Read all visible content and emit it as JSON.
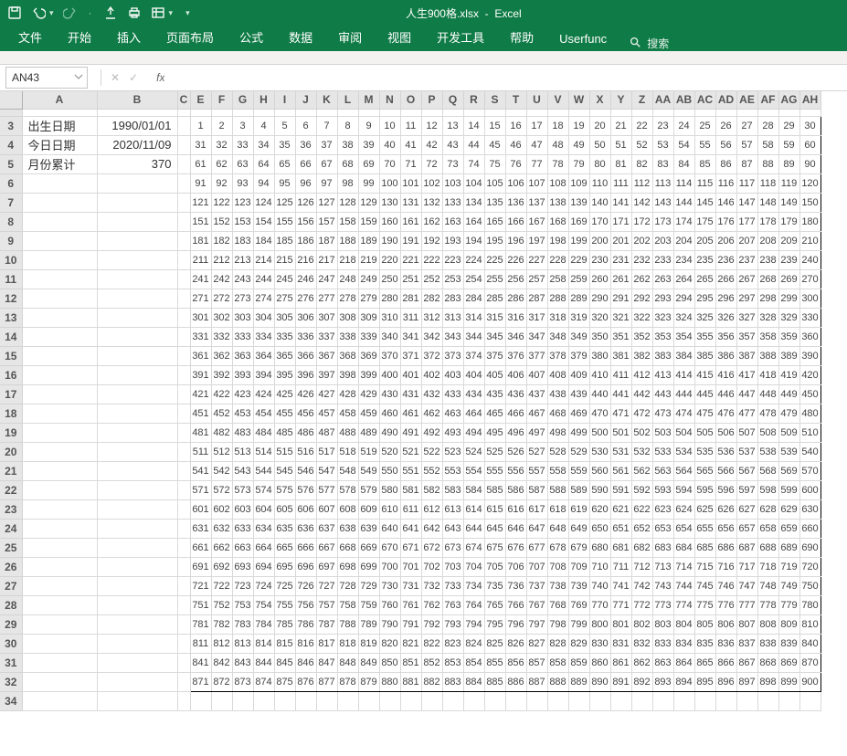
{
  "app": {
    "filename": "人生900格.xlsx",
    "appname": "Excel"
  },
  "qat": {
    "save": "save",
    "undo": "undo",
    "redo": "redo",
    "touch": "touch",
    "print": "print",
    "table": "table",
    "more": "▾"
  },
  "ribbon": {
    "tabs": [
      "文件",
      "开始",
      "插入",
      "页面布局",
      "公式",
      "数据",
      "审阅",
      "视图",
      "开发工具",
      "帮助",
      "Userfunc"
    ],
    "search_icon": "🔍",
    "search_text": "搜索"
  },
  "namebox": {
    "ref": "AN43"
  },
  "fxbar": {
    "cancel": "✕",
    "confirm": "✓",
    "fx": "fx",
    "value": ""
  },
  "labels": {
    "birth_label": "出生日期",
    "birth_value": "1990/01/01",
    "today_label": "今日日期",
    "today_value": "2020/11/09",
    "months_label": "月份累计",
    "months_value": "370"
  },
  "columns_de": [
    "A",
    "B",
    "C",
    "E",
    "F",
    "G",
    "H",
    "I",
    "J",
    "K",
    "L",
    "M",
    "N",
    "O",
    "P",
    "Q",
    "R",
    "S",
    "T",
    "U",
    "V",
    "W",
    "X",
    "Y",
    "Z",
    "AA",
    "AB",
    "AC",
    "AD",
    "AE",
    "AF",
    "AG",
    "AH"
  ],
  "colA_w": 82,
  "colB_w": 88,
  "colC_w": 14,
  "gridcol_w": 23,
  "grid": {
    "rows": 30,
    "cols": 30,
    "start": 1
  },
  "chart_data": {
    "type": "table",
    "title": "人生900格",
    "rows": 30,
    "cols": 30,
    "values_desc": "Sequential integers 1..900 filling a 30x30 grid row-major",
    "start": 1,
    "end": 900
  }
}
